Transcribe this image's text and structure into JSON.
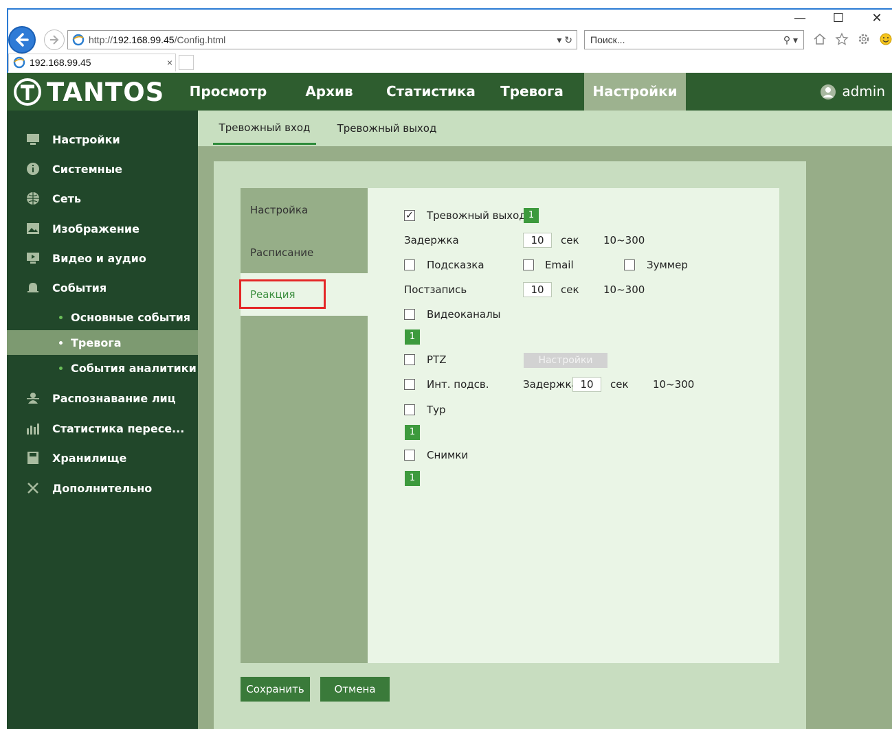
{
  "window": {
    "minimize_glyph": "—",
    "maximize_glyph": "☐",
    "close_glyph": "✕"
  },
  "browser": {
    "address_prefix": "http://",
    "address_host": "192.168.99.45",
    "address_path": "/Config.html",
    "address_tools": "▾ ↻",
    "search_placeholder": "Поиск...",
    "search_tools": "⚲ ▾",
    "tab_title": "192.168.99.45",
    "tab_close": "×",
    "icons": [
      "home-icon",
      "star-icon",
      "gear-icon",
      "smiley-icon"
    ]
  },
  "app": {
    "brand": "TANTOS",
    "nav": [
      {
        "label": "Просмотр"
      },
      {
        "label": "Архив"
      },
      {
        "label": "Статистика"
      },
      {
        "label": "Тревога"
      },
      {
        "label": "Настройки"
      }
    ],
    "user": "admin",
    "sidebar": {
      "items": [
        {
          "label": "Настройки",
          "icon": "settings-icon"
        },
        {
          "label": "Системные",
          "icon": "info-icon"
        },
        {
          "label": "Сеть",
          "icon": "globe-icon"
        },
        {
          "label": "Изображение",
          "icon": "image-icon"
        },
        {
          "label": "Видео и аудио",
          "icon": "video-icon"
        },
        {
          "label": "События",
          "icon": "bell-icon"
        }
      ],
      "sub_items": [
        {
          "label": "Основные события"
        },
        {
          "label": "Тревога"
        },
        {
          "label": "События аналитики"
        }
      ],
      "items_after": [
        {
          "label": "Распознавание лиц",
          "icon": "face-icon"
        },
        {
          "label": "Статистика пересе...",
          "icon": "chart-icon"
        },
        {
          "label": "Хранилище",
          "icon": "storage-icon"
        },
        {
          "label": "Дополнительно",
          "icon": "tools-icon"
        }
      ]
    },
    "tabs": [
      {
        "label": "Тревожный вход"
      },
      {
        "label": "Тревожный выход"
      }
    ],
    "left_tabs": [
      {
        "label": "Настройка"
      },
      {
        "label": "Расписание"
      },
      {
        "label": "Реакция"
      }
    ],
    "form": {
      "alarm_output_label": "Тревожный выход",
      "alarm_output_channel": "1",
      "delay_label": "Задержка",
      "delay_value": "10",
      "sec": "сек",
      "range": "10~300",
      "hint_label": "Подсказка",
      "email_label": "Email",
      "buzzer_label": "Зуммер",
      "postrecord_label": "Постзапись",
      "postrecord_value": "10",
      "video_channels_label": "Видеоканалы",
      "video_channel": "1",
      "ptz_label": "PTZ",
      "ptz_button": "Настройки",
      "ir_label": "Инт. подсв.",
      "ir_delay_label": "Задержка",
      "ir_delay_value": "10",
      "tour_label": "Тур",
      "tour_channel": "1",
      "snapshots_label": "Снимки",
      "snapshot_channel": "1"
    },
    "buttons": {
      "save": "Сохранить",
      "cancel": "Отмена"
    }
  }
}
